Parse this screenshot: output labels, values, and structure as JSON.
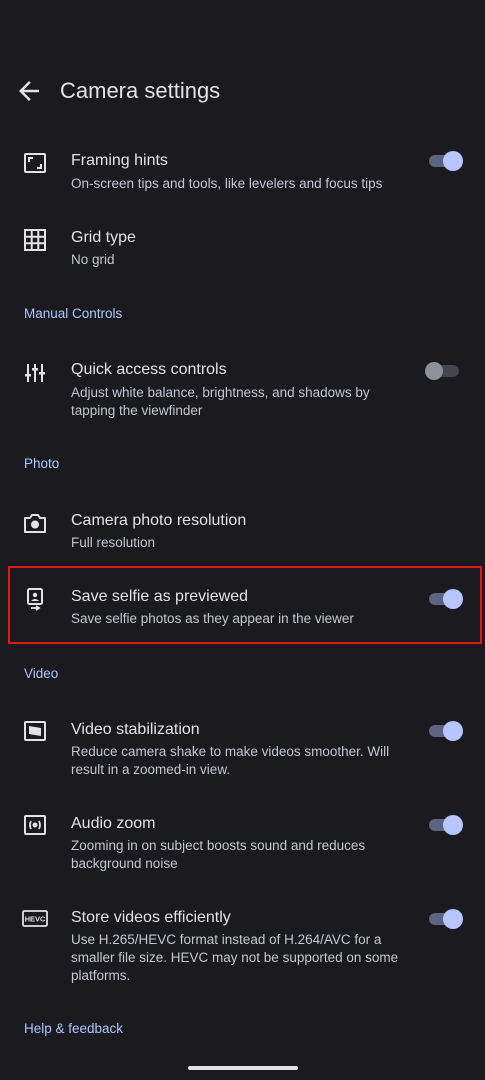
{
  "header": {
    "title": "Camera settings"
  },
  "items": {
    "framing_hints": {
      "title": "Framing hints",
      "subtitle": "On-screen tips and tools, like levelers and focus tips",
      "enabled": true
    },
    "grid_type": {
      "title": "Grid type",
      "subtitle": "No grid"
    },
    "quick_access": {
      "title": "Quick access controls",
      "subtitle": "Adjust white balance, brightness, and shadows by tapping the viewfinder",
      "enabled": false
    },
    "photo_resolution": {
      "title": "Camera photo resolution",
      "subtitle": "Full resolution"
    },
    "save_selfie": {
      "title": "Save selfie as previewed",
      "subtitle": "Save selfie photos as they appear in the viewer",
      "enabled": true
    },
    "video_stabilization": {
      "title": "Video stabilization",
      "subtitle": "Reduce camera shake to make videos smoother. Will result in a zoomed-in view.",
      "enabled": true
    },
    "audio_zoom": {
      "title": "Audio zoom",
      "subtitle": "Zooming in on subject boosts sound and reduces background noise",
      "enabled": true
    },
    "store_efficiently": {
      "title": "Store videos efficiently",
      "subtitle": "Use H.265/HEVC format instead of H.264/AVC for a smaller file size. HEVC may not be supported on some platforms.",
      "enabled": true,
      "icon_text": "HEVC"
    }
  },
  "sections": {
    "manual_controls": "Manual Controls",
    "photo": "Photo",
    "video": "Video",
    "help_feedback": "Help & feedback"
  },
  "colors": {
    "background": "#1b1b1f",
    "accent": "#aec6ff",
    "toggle_on_thumb": "#b7c6ff",
    "highlight": "#d81b1b"
  }
}
